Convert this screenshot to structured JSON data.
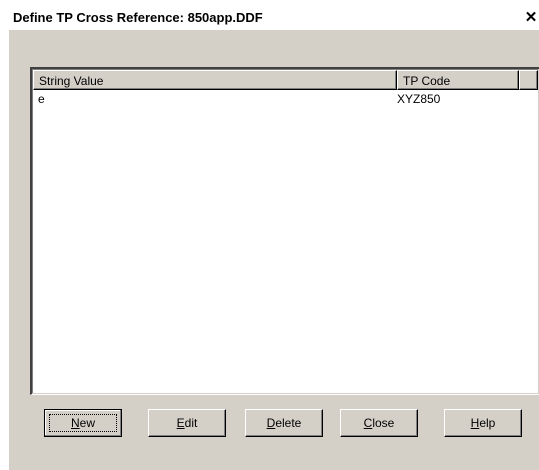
{
  "window": {
    "title": "Define TP Cross Reference: 850app.DDF",
    "close_glyph": "✕"
  },
  "list": {
    "columns": [
      {
        "label": "String Value"
      },
      {
        "label": "TP Code"
      }
    ],
    "rows": [
      {
        "string_value": "e",
        "tp_code": "XYZ850"
      }
    ]
  },
  "buttons": {
    "new": {
      "mnemonic": "N",
      "rest": "ew"
    },
    "edit": {
      "mnemonic": "E",
      "rest": "dit"
    },
    "delete": {
      "mnemonic": "D",
      "rest": "elete"
    },
    "close": {
      "mnemonic": "C",
      "rest": "lose"
    },
    "help": {
      "mnemonic": "H",
      "rest": "elp"
    }
  },
  "colors": {
    "dialog_face": "#d4d0c8",
    "list_background": "#ffffff",
    "titlebar_background": "#ffffff"
  }
}
